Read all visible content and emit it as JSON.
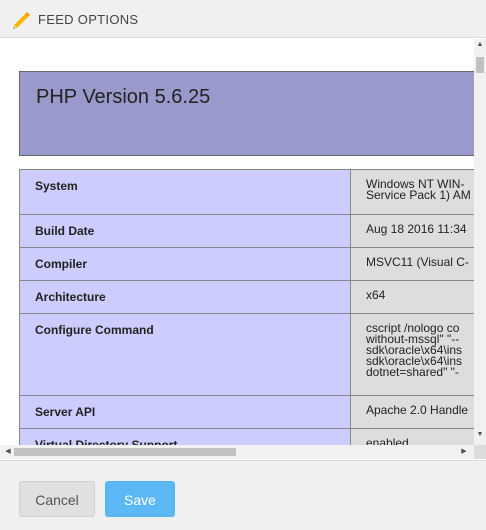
{
  "header": {
    "title": "FEED OPTIONS",
    "icon": "pencil-icon",
    "icon_color": "#f5b800"
  },
  "phpinfo": {
    "title": "PHP Version 5.6.25",
    "header_color": "#9999cc",
    "key_color": "#ccccff",
    "value_color": "#dddddd",
    "rows": [
      {
        "key": "System",
        "value": [
          "Windows NT WIN-",
          "Service Pack 1) AM"
        ]
      },
      {
        "key": "Build Date",
        "value": [
          "Aug 18 2016 11:34"
        ]
      },
      {
        "key": "Compiler",
        "value": [
          "MSVC11 (Visual C-"
        ]
      },
      {
        "key": "Architecture",
        "value": [
          "x64"
        ]
      },
      {
        "key": "Configure Command",
        "value": [
          "cscript /nologo co",
          "without-mssql\" \"--",
          "sdk\\oracle\\x64\\ins",
          "sdk\\oracle\\x64\\ins",
          "dotnet=shared\" \"-"
        ]
      },
      {
        "key": "Server API",
        "value": [
          "Apache 2.0 Handle"
        ]
      },
      {
        "key": "Virtual Directory Support",
        "value": [
          "enabled"
        ]
      }
    ]
  },
  "footer": {
    "cancel_label": "Cancel",
    "save_label": "Save",
    "save_color": "#5cb8f5"
  }
}
